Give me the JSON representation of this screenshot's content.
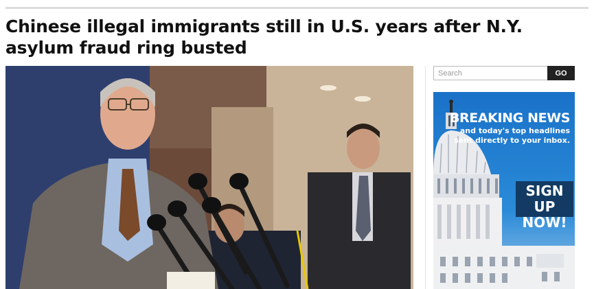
{
  "article": {
    "headline": "Chinese illegal immigrants still in U.S. years after N.Y. asylum fraud ring busted",
    "photo_icon": "photo-press-conference"
  },
  "sidebar": {
    "search": {
      "placeholder": "Search",
      "button_label": "GO"
    },
    "ad": {
      "title": "BREAKING NEWS",
      "subtitle": "and today's top headlines sent directly to your inbox.",
      "cta_line1": "SIGN UP",
      "cta_line2": "NOW!",
      "icon": "capitol-dome-icon"
    }
  },
  "colors": {
    "headline": "#111111",
    "go_button": "#222222",
    "ad_background": "#1a72c8",
    "ad_cta": "#123a63"
  }
}
